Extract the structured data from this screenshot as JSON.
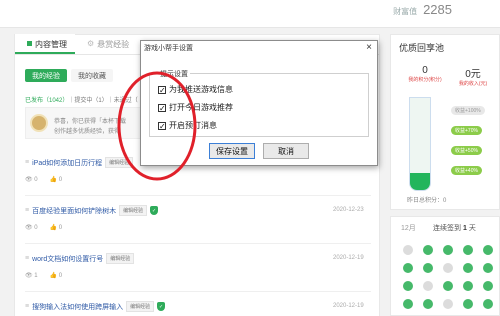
{
  "header": {
    "wealth_label": "财富值",
    "wealth_value": "2285"
  },
  "left": {
    "tabs": [
      {
        "label": "内容管理"
      },
      {
        "label": "悬赏经验"
      }
    ],
    "subtabs": [
      {
        "label": "我的经验"
      },
      {
        "label": "我的收藏"
      }
    ],
    "status_published": "已发布（1042）",
    "status_submitting": "提交中（1）",
    "status_not_passed": "未通过（",
    "notice_line1": "恭喜，你已获得「本杯下载",
    "notice_line2": "创作越多优质经验，获得",
    "edit_label": "编辑经验",
    "articles": [
      {
        "title": "iPad如何添加日历行程",
        "views": "0",
        "likes": "0",
        "date": "",
        "shield": false
      },
      {
        "title": "百度经验里面如何铲除树木",
        "views": "0",
        "likes": "0",
        "date": "2020-12-23",
        "shield": true
      },
      {
        "title": "word文档如何设置行号",
        "views": "1",
        "likes": "0",
        "date": "2020-12-19",
        "shield": false
      },
      {
        "title": "搜狗输入法如何使用跨屏输入",
        "views": "",
        "likes": "",
        "date": "2020-12-19",
        "shield": true
      }
    ]
  },
  "right": {
    "title": "优质回享池",
    "stats": [
      {
        "value": "0",
        "label": "我的积分(积分)"
      },
      {
        "value": "0元",
        "label": "我的收入(元)"
      }
    ],
    "fill_fraction": 0.18,
    "markers": [
      {
        "label": "收益+100%"
      },
      {
        "label": "收益+70%"
      },
      {
        "label": "收益+50%"
      },
      {
        "label": "收益+40%"
      }
    ],
    "yesterday_label": "昨日总积分",
    "yesterday_value": "0",
    "calendar": {
      "month": "12月",
      "streak_label": "连续签到",
      "streak_value": "1",
      "streak_unit": "天"
    }
  },
  "dialog": {
    "title": "游戏小帮手设置",
    "group_label": "提示设置",
    "options": [
      {
        "label": "为我推送游戏信息",
        "checked": true
      },
      {
        "label": "打开今日游戏推荐",
        "checked": true
      },
      {
        "label": "开启预订消息",
        "checked": true
      }
    ],
    "save_label": "保存设置",
    "cancel_label": "取消"
  },
  "colors": {
    "accent": "#2eab5a",
    "annotation": "#e0202a"
  }
}
